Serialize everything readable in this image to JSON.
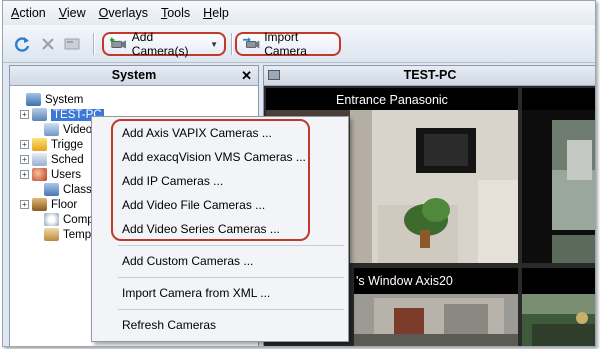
{
  "menu": [
    "Action",
    "View",
    "Overlays",
    "Tools",
    "Help"
  ],
  "toolbar": {
    "add_cameras_label": "Add Camera(s)",
    "import_camera_label": "Import Camera"
  },
  "system_panel": {
    "title": "System",
    "close_glyph": "✕",
    "tree": [
      {
        "label": "System",
        "icon": "system-icon",
        "expander": ""
      },
      {
        "label": "TEST-PC",
        "icon": "server-icon",
        "expander": "+"
      },
      {
        "label": "Video",
        "icon": "video-icon",
        "expander": ""
      },
      {
        "label": "Trigge",
        "icon": "trigger-icon",
        "expander": "+"
      },
      {
        "label": "Sched",
        "icon": "schedule-icon",
        "expander": "+"
      },
      {
        "label": "Users",
        "icon": "users-icon",
        "expander": "+"
      },
      {
        "label": "Classi",
        "icon": "classification-icon",
        "expander": ""
      },
      {
        "label": "Floor",
        "icon": "floor-icon",
        "expander": "+"
      },
      {
        "label": "Comp",
        "icon": "compute-icon",
        "expander": ""
      },
      {
        "label": "Temp",
        "icon": "template-icon",
        "expander": ""
      }
    ]
  },
  "video_panel": {
    "title": "TEST-PC",
    "feeds": [
      {
        "title": "Entrance Panasonic"
      },
      {
        "title": "'s Window Axis20"
      }
    ]
  },
  "context_menu": {
    "items": [
      "Add Axis VAPIX Cameras ...",
      "Add exacqVision VMS Cameras ...",
      "Add IP Cameras ...",
      "Add Video File Cameras ...",
      "Add Video Series Cameras ...",
      "Add Custom Cameras ...",
      "Import Camera from XML ...",
      "Refresh Cameras"
    ]
  },
  "colors": {
    "highlight": "#c0392b",
    "selection": "#3c78d8"
  }
}
